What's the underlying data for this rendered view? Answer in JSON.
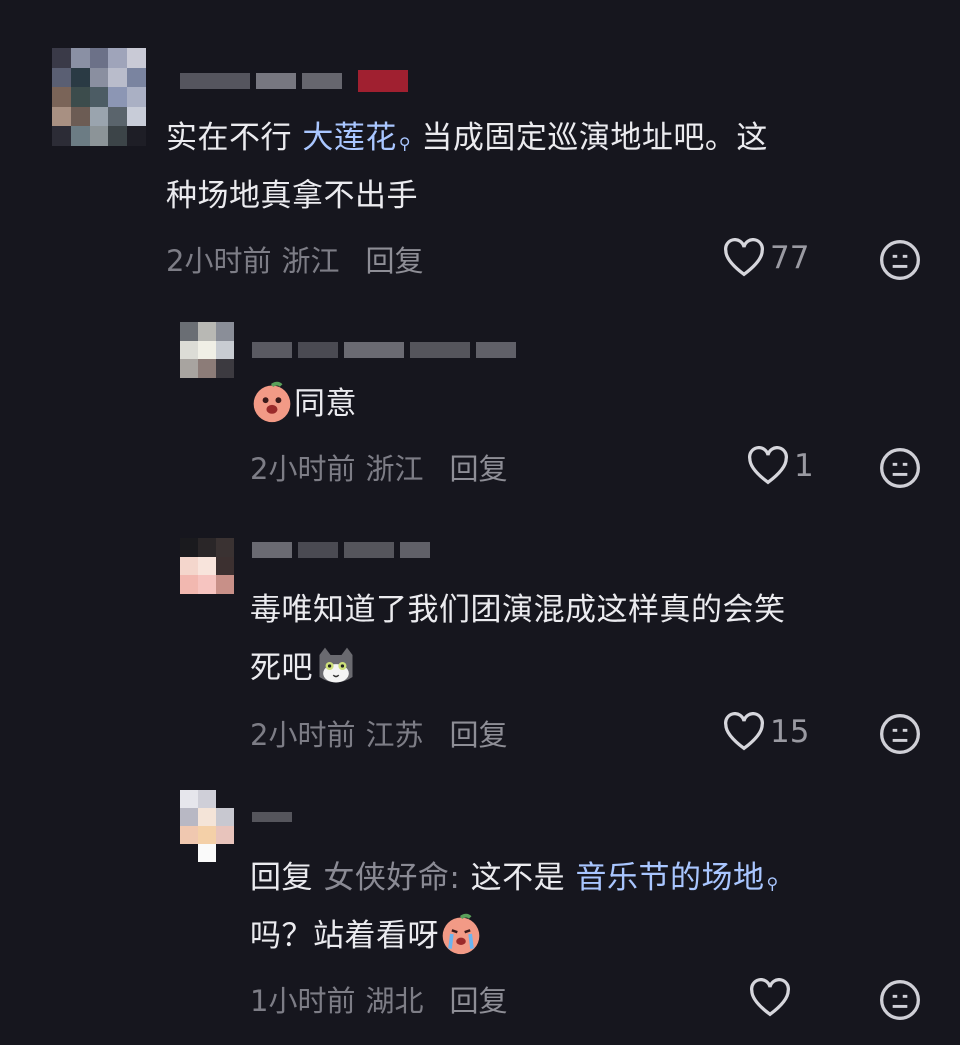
{
  "comments": [
    {
      "text_before": "实在不行 ",
      "link": "大莲花",
      "text_after": " 当成固定巡演地址吧。这",
      "line2": "种场地真拿不出手",
      "time": "2小时前",
      "location": "浙江",
      "reply_label": "回复",
      "likes": "77"
    },
    {
      "text": "同意",
      "time": "2小时前",
      "location": "浙江",
      "reply_label": "回复",
      "likes": "1"
    },
    {
      "text": "毒唯知道了我们团演混成这样真的会笑",
      "line2": "死吧",
      "time": "2小时前",
      "location": "江苏",
      "reply_label": "回复",
      "likes": "15"
    },
    {
      "reply_prefix": "回复 ",
      "mention": "女侠好命:",
      "text_mid": " 这不是 ",
      "link": "音乐节的场地",
      "line2": "吗？站着看呀",
      "time": "1小时前",
      "location": "湖北",
      "reply_label": "回复",
      "likes": ""
    }
  ],
  "icons": {
    "like": "heart-outline-icon",
    "emoji": "neutral-face-icon",
    "search_link": "search-icon"
  },
  "colors": {
    "background": "#16161e",
    "link": "#a9c6ff",
    "meta": "#7d7d86"
  }
}
